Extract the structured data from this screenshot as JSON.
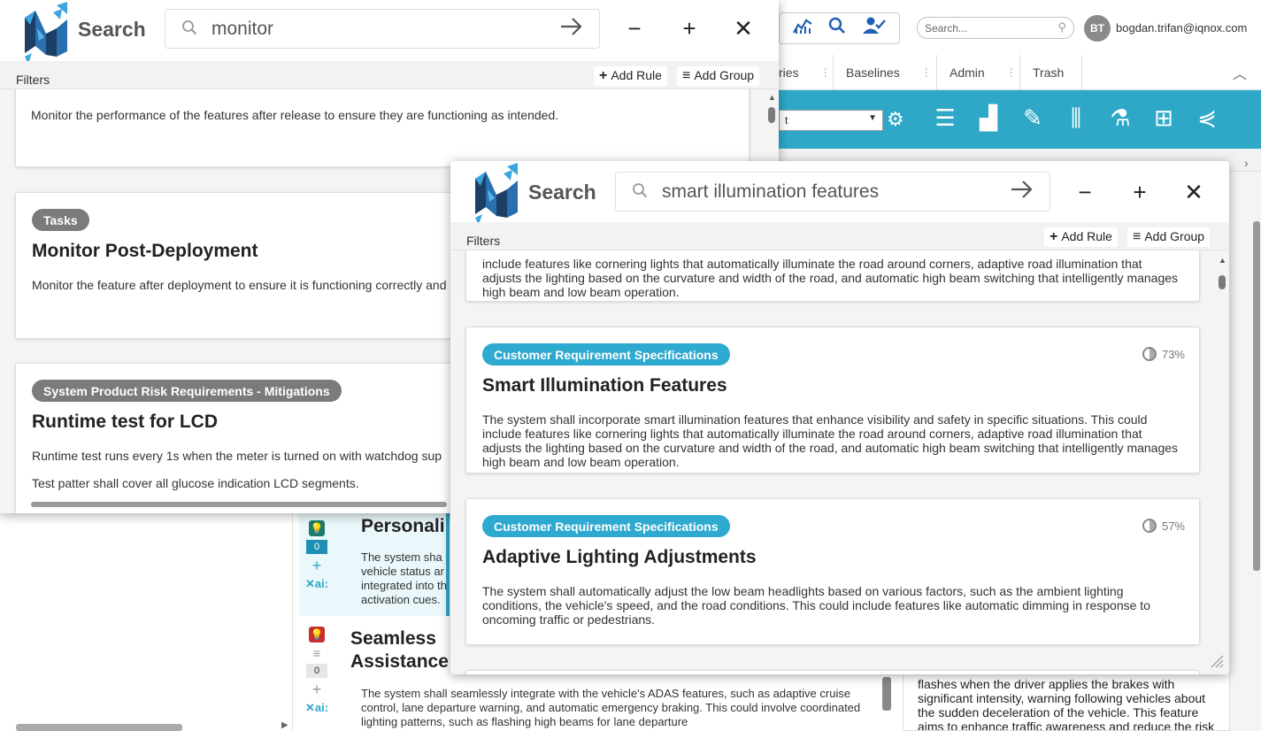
{
  "background_app": {
    "user": {
      "initials": "BT",
      "email": "bogdan.trifan@iqnox.com"
    },
    "search_placeholder": "Search...",
    "tabs": [
      {
        "label": "ries"
      },
      {
        "label": "Baselines"
      },
      {
        "label": "Admin"
      },
      {
        "label": "Trash"
      }
    ],
    "select_value": "t",
    "requirements": [
      {
        "title": "Personali",
        "count": "0",
        "ai": "✕ai:",
        "text": "The system sha vehicle status ar integrated into th activation cues."
      },
      {
        "title": "Seamless Assistance",
        "count": "0",
        "ai": "✕ai:",
        "text": "The system shall seamlessly integrate with the vehicle's ADAS features, such as adaptive cruise control, lane departure warning, and automatic emergency braking. This could involve coordinated lighting patterns, such as flashing high beams for lane departure"
      }
    ],
    "right_card_text": "flashes when the driver applies the brakes with significant intensity, warning following vehicles about the sudden deceleration of the vehicle. This feature aims to enhance traffic awareness and reduce the risk"
  },
  "search_window_1": {
    "title": "Search",
    "query": "monitor",
    "filters_label": "Filters",
    "add_rule": "Add Rule",
    "add_group": "Add Group",
    "results": [
      {
        "category": "",
        "title": "",
        "text": "Monitor the performance of the features after release to ensure they are functioning as intended."
      },
      {
        "category": "Tasks",
        "title": "Monitor Post-Deployment",
        "text": "Monitor the feature after deployment to ensure it is functioning correctly and"
      },
      {
        "category": "System Product Risk Requirements - Mitigations",
        "title": "Runtime test for LCD",
        "text": "Runtime test runs every 1s when the meter is turned on with watchdog sup",
        "text2": "Test patter shall cover all glucose indication LCD segments."
      }
    ]
  },
  "search_window_2": {
    "title": "Search",
    "query": "smart illumination features",
    "filters_label": "Filters",
    "add_rule": "Add Rule",
    "add_group": "Add Group",
    "results": [
      {
        "category": "",
        "title": "",
        "text": "include features like cornering lights that automatically illuminate the road around corners, adaptive road illumination that adjusts the lighting based on the curvature and width of the road, and automatic high beam switching that intelligently manages high beam and low beam operation."
      },
      {
        "category": "Customer Requirement Specifications",
        "title": "Smart Illumination Features",
        "score": "73%",
        "text": "The system shall incorporate smart illumination features that enhance visibility and safety in specific situations. This could include features like cornering lights that automatically illuminate the road around corners, adaptive road illumination that adjusts the lighting based on the curvature and width of the road, and automatic high beam switching that intelligently manages high beam and low beam operation."
      },
      {
        "category": "Customer Requirement Specifications",
        "title": "Adaptive Lighting Adjustments",
        "score": "57%",
        "text": "The system shall automatically adjust the low beam headlights based on various factors, such as the ambient lighting conditions, the vehicle's speed, and the road conditions. This could include features like automatic dimming in response to oncoming traffic or pedestrians."
      }
    ]
  },
  "colors": {
    "accent": "#2fa8c8",
    "badge_blue": "#2ea9cf",
    "badge_grey": "#7b7b7b",
    "logo_dark": "#1d3f66",
    "logo_light": "#3aa6dd"
  }
}
